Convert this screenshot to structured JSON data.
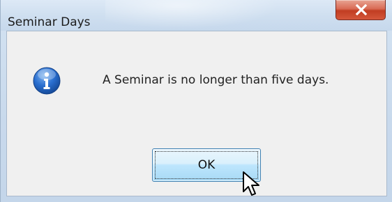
{
  "window": {
    "title": "Seminar Days",
    "close_icon": "close-icon"
  },
  "message": {
    "icon": "info-icon",
    "text": "A Seminar is no longer than five days."
  },
  "buttons": {
    "ok_label": "OK"
  },
  "colors": {
    "close_button": "#c9452b",
    "ok_button_border": "#3c7fb1",
    "dialog_background": "#f0f0f0",
    "info_icon": "#1f5fb6"
  }
}
